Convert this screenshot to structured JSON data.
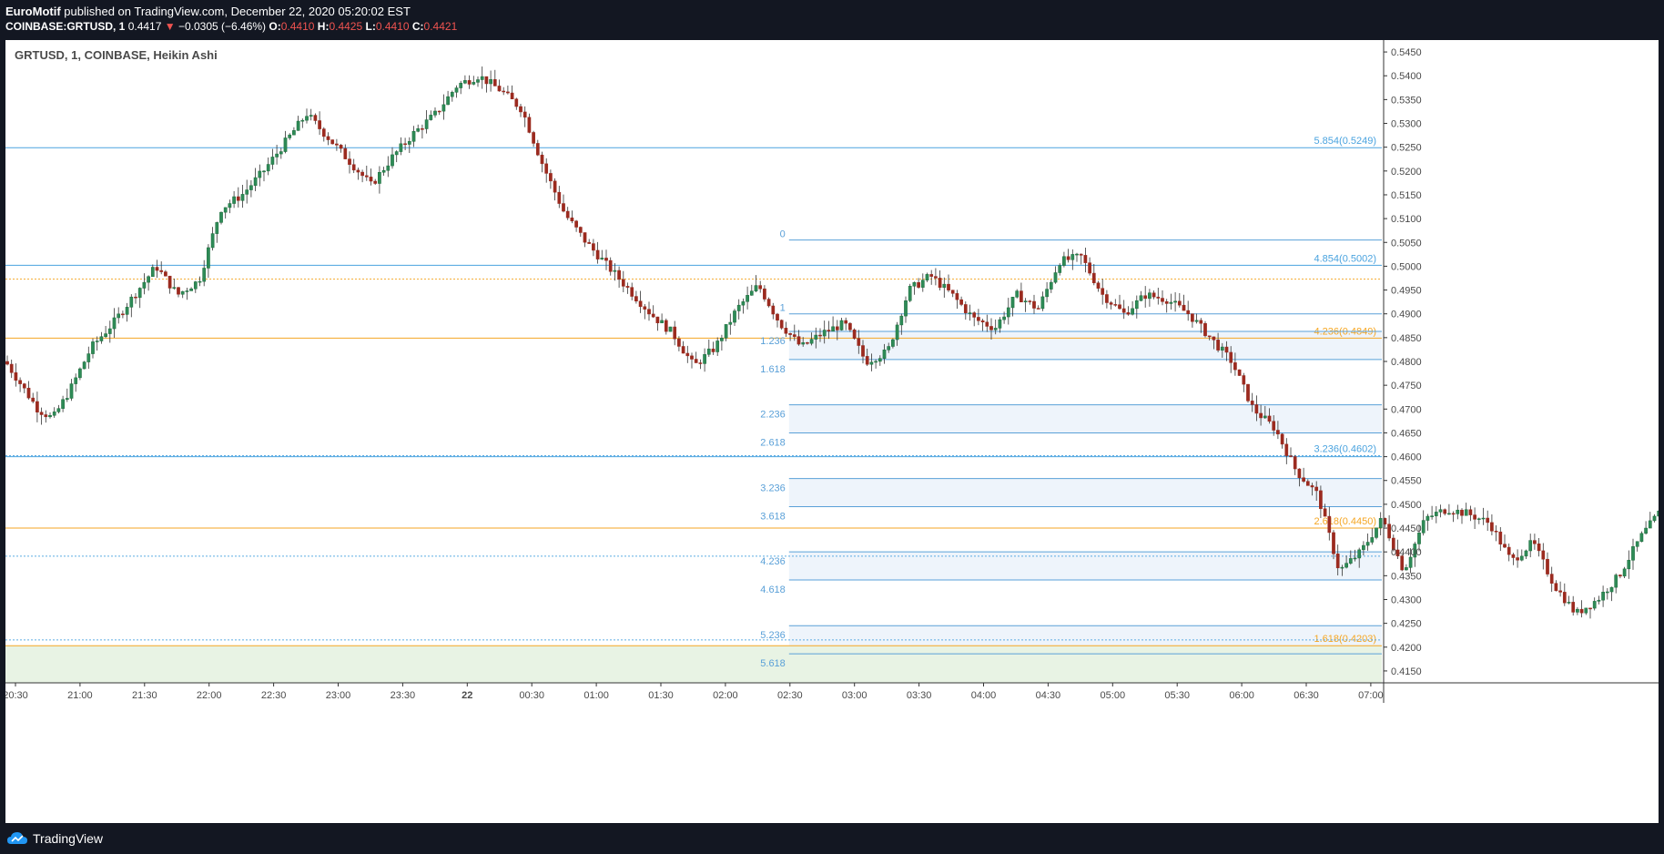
{
  "header": {
    "author": "EuroMotif",
    "published_text": "published on TradingView.com, December 22, 2020 05:20:02 EST",
    "symbol": "COINBASE:GRTUSD, 1",
    "last": "0.4417",
    "change_arrow": "▼",
    "change": "−0.0305 (−6.46%)",
    "o_label": "O:",
    "o_value": "0.4410",
    "h_label": "H:",
    "h_value": "0.4425",
    "l_label": "L:",
    "l_value": "0.4410",
    "c_label": "C:",
    "c_value": "0.4421"
  },
  "legend": {
    "title": "GRTUSD, 1, COINBASE, Heikin Ashi"
  },
  "footer": {
    "brand": "TradingView"
  },
  "colors": {
    "up": "#26a69a",
    "up_dark": "#1b6b3a",
    "down": "#9b2a1f",
    "blue_line": "#4aa3df",
    "orange_line": "#f5a623",
    "grid_text": "#4a4a4a",
    "fib_label": "#5aa0d8",
    "fill_blue": "#eef4fb",
    "fill_green": "#e8f3e4"
  },
  "chart_data": {
    "type": "candlestick",
    "style": "Heikin Ashi",
    "title": "GRTUSD, 1, COINBASE, Heikin Ashi",
    "ylim": [
      0.4125,
      0.5475
    ],
    "y_ticks": [
      "0.5450",
      "0.5400",
      "0.5350",
      "0.5300",
      "0.5250",
      "0.5200",
      "0.5150",
      "0.5100",
      "0.5050",
      "0.5000",
      "0.4950",
      "0.4900",
      "0.4850",
      "0.4800",
      "0.4750",
      "0.4700",
      "0.4650",
      "0.4600",
      "0.4550",
      "0.4500",
      "0.4450",
      "0.4400",
      "0.4350",
      "0.4300",
      "0.4250",
      "0.4200",
      "0.4150"
    ],
    "x_ticks": [
      "20:30",
      "21:00",
      "21:30",
      "22:00",
      "22:30",
      "23:00",
      "23:30",
      "22",
      "00:30",
      "01:00",
      "01:30",
      "02:00",
      "02:30",
      "03:00",
      "03:30",
      "04:00",
      "04:30",
      "05:00",
      "05:30",
      "06:00",
      "06:30",
      "07:00"
    ],
    "price_path": [
      [
        "20:30",
        0.48
      ],
      [
        "20:45",
        0.47
      ],
      [
        "20:52",
        0.468
      ],
      [
        "21:00",
        0.474
      ],
      [
        "21:10",
        0.483
      ],
      [
        "21:20",
        0.488
      ],
      [
        "21:30",
        0.494
      ],
      [
        "21:40",
        0.5
      ],
      [
        "21:50",
        0.494
      ],
      [
        "22:00",
        0.497
      ],
      [
        "22:10",
        0.512
      ],
      [
        "22:20",
        0.515
      ],
      [
        "22:30",
        0.52
      ],
      [
        "22:40",
        0.526
      ],
      [
        "22:50",
        0.532
      ],
      [
        "23:00",
        0.527
      ],
      [
        "23:10",
        0.522
      ],
      [
        "23:20",
        0.517
      ],
      [
        "23:30",
        0.523
      ],
      [
        "23:40",
        0.528
      ],
      [
        "23:50",
        0.532
      ],
      [
        "00:00",
        0.538
      ],
      [
        "00:10",
        0.54
      ],
      [
        "00:20",
        0.537
      ],
      [
        "00:30",
        0.533
      ],
      [
        "00:40",
        0.521
      ],
      [
        "00:50",
        0.511
      ],
      [
        "01:00",
        0.505
      ],
      [
        "01:10",
        0.5
      ],
      [
        "01:20",
        0.495
      ],
      [
        "01:30",
        0.49
      ],
      [
        "01:40",
        0.486
      ],
      [
        "01:50",
        0.479
      ],
      [
        "02:00",
        0.483
      ],
      [
        "02:10",
        0.491
      ],
      [
        "02:20",
        0.496
      ],
      [
        "02:30",
        0.488
      ],
      [
        "02:40",
        0.483
      ],
      [
        "02:50",
        0.486
      ],
      [
        "03:00",
        0.488
      ],
      [
        "03:10",
        0.48
      ],
      [
        "03:20",
        0.482
      ],
      [
        "03:30",
        0.495
      ],
      [
        "03:40",
        0.498
      ],
      [
        "03:50",
        0.494
      ],
      [
        "04:00",
        0.489
      ],
      [
        "04:10",
        0.487
      ],
      [
        "04:20",
        0.494
      ],
      [
        "04:30",
        0.491
      ],
      [
        "04:40",
        0.501
      ],
      [
        "04:50",
        0.502
      ],
      [
        "05:00",
        0.494
      ],
      [
        "05:10",
        0.49
      ],
      [
        "05:20",
        0.494
      ],
      [
        "05:30",
        0.493
      ],
      [
        "05:40",
        0.49
      ],
      [
        "05:50",
        0.485
      ],
      [
        "06:00",
        0.48
      ],
      [
        "06:10",
        0.47
      ],
      [
        "06:20",
        0.466
      ],
      [
        "06:30",
        0.457
      ],
      [
        "06:40",
        0.452
      ],
      [
        "06:50",
        0.436
      ],
      [
        "07:00",
        0.44
      ],
      [
        "07:10",
        0.447
      ],
      [
        "07:20",
        0.436
      ],
      [
        "07:30",
        0.447
      ],
      [
        "07:40",
        0.449
      ],
      [
        "07:50",
        0.448
      ],
      [
        "08:00",
        0.446
      ],
      [
        "08:10",
        0.438
      ],
      [
        "08:20",
        0.442
      ],
      [
        "08:30",
        0.433
      ],
      [
        "08:40",
        0.427
      ],
      [
        "08:50",
        0.43
      ],
      [
        "09:00",
        0.435
      ],
      [
        "09:10",
        0.443
      ],
      [
        "09:20",
        0.449
      ],
      [
        "09:30",
        0.444
      ],
      [
        "09:40",
        0.4417
      ]
    ],
    "horizontal_lines": [
      {
        "price": 0.5249,
        "label": "5.854(0.5249)",
        "color": "blue"
      },
      {
        "price": 0.5002,
        "label": "4.854(0.5002)",
        "color": "blue"
      },
      {
        "price": 0.4973,
        "label": "",
        "color": "orange",
        "dotted": true
      },
      {
        "price": 0.4849,
        "label": "4.236(0.4849)",
        "color": "orange"
      },
      {
        "price": 0.4602,
        "label": "3.236(0.4602)",
        "color": "blue",
        "dotted": true
      },
      {
        "price": 0.46,
        "label": "",
        "color": "blue"
      },
      {
        "price": 0.445,
        "label": "2.618(0.4450)",
        "color": "orange"
      },
      {
        "price": 0.4391,
        "label": "",
        "color": "blue",
        "dotted": true
      },
      {
        "price": 0.4203,
        "label": "1.618(0.4203)",
        "color": "orange"
      },
      {
        "price": 0.4215,
        "label": "",
        "color": "blue",
        "dotted": true
      }
    ],
    "fib_extension": [
      {
        "level": "0",
        "price": 0.5055
      },
      {
        "level": "1",
        "price": 0.49
      },
      {
        "level": "1.236",
        "price": 0.4863
      },
      {
        "level": "1.618",
        "price": 0.4804
      },
      {
        "level": "2.236",
        "price": 0.4709
      },
      {
        "level": "2.618",
        "price": 0.465
      },
      {
        "level": "3.236",
        "price": 0.4554
      },
      {
        "level": "3.618",
        "price": 0.4495
      },
      {
        "level": "4.236",
        "price": 0.44
      },
      {
        "level": "4.618",
        "price": 0.4341
      },
      {
        "level": "5.236",
        "price": 0.4245
      },
      {
        "level": "5.618",
        "price": 0.4186
      }
    ],
    "fib_start_time": "02:30"
  }
}
